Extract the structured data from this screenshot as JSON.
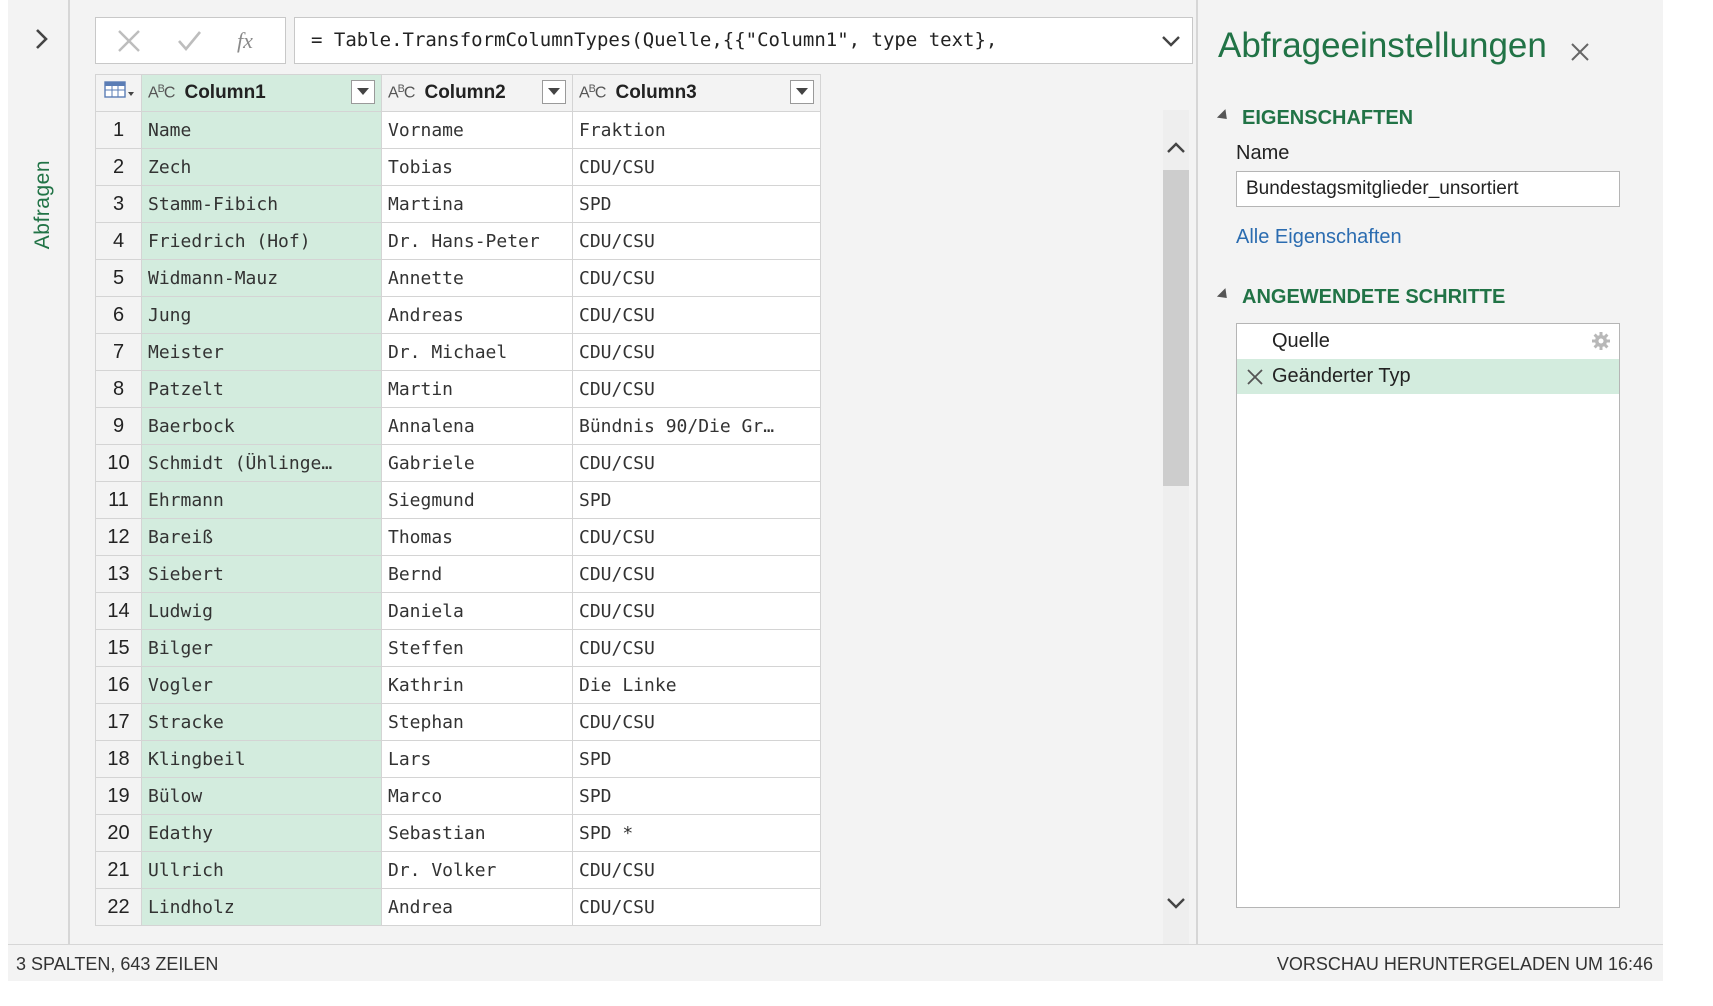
{
  "nav": {
    "label": "Abfragen"
  },
  "formula": {
    "text": "= Table.TransformColumnTypes(Quelle,{{\"Column1\", type text},"
  },
  "table": {
    "type_icon": "A B C",
    "columns": [
      "Column1",
      "Column2",
      "Column3"
    ],
    "rows": [
      [
        "1",
        "Name",
        "Vorname",
        "Fraktion"
      ],
      [
        "2",
        "Zech",
        "Tobias",
        "CDU/CSU"
      ],
      [
        "3",
        "Stamm-Fibich",
        "Martina",
        "SPD"
      ],
      [
        "4",
        "Friedrich (Hof)",
        "Dr. Hans-Peter",
        "CDU/CSU"
      ],
      [
        "5",
        "Widmann-Mauz",
        "Annette",
        "CDU/CSU"
      ],
      [
        "6",
        "Jung",
        "Andreas",
        "CDU/CSU"
      ],
      [
        "7",
        "Meister",
        "Dr. Michael",
        "CDU/CSU"
      ],
      [
        "8",
        "Patzelt",
        "Martin",
        "CDU/CSU"
      ],
      [
        "9",
        "Baerbock",
        "Annalena",
        "Bündnis 90/Die Gr…"
      ],
      [
        "10",
        "Schmidt (Ühlinge…",
        "Gabriele",
        "CDU/CSU"
      ],
      [
        "11",
        "Ehrmann",
        "Siegmund",
        "SPD"
      ],
      [
        "12",
        "Bareiß",
        "Thomas",
        "CDU/CSU"
      ],
      [
        "13",
        "Siebert",
        "Bernd",
        "CDU/CSU"
      ],
      [
        "14",
        "Ludwig",
        "Daniela",
        "CDU/CSU"
      ],
      [
        "15",
        "Bilger",
        "Steffen",
        "CDU/CSU"
      ],
      [
        "16",
        "Vogler",
        "Kathrin",
        "Die Linke"
      ],
      [
        "17",
        "Stracke",
        "Stephan",
        "CDU/CSU"
      ],
      [
        "18",
        "Klingbeil",
        "Lars",
        "SPD"
      ],
      [
        "19",
        "Bülow",
        "Marco",
        "SPD"
      ],
      [
        "20",
        "Edathy",
        "Sebastian",
        "SPD *"
      ],
      [
        "21",
        "Ullrich",
        "Dr. Volker",
        "CDU/CSU"
      ],
      [
        "22",
        "Lindholz",
        "Andrea",
        "CDU/CSU"
      ]
    ]
  },
  "panel": {
    "title": "Abfrageeinstellungen",
    "properties_heading": "EIGENSCHAFTEN",
    "name_label": "Name",
    "name_value": "Bundestagsmitglieder_unsortiert",
    "all_properties_link": "Alle Eigenschaften",
    "steps_heading": "ANGEWENDETE SCHRITTE",
    "steps": [
      "Quelle",
      "Geänderter Typ"
    ]
  },
  "status": {
    "left": "3 SPALTEN, 643 ZEILEN",
    "right": "VORSCHAU HERUNTERGELADEN UM 16:46"
  },
  "colors": {
    "accent": "#217346",
    "selection": "#d3ecde",
    "link": "#2b6cb0"
  }
}
